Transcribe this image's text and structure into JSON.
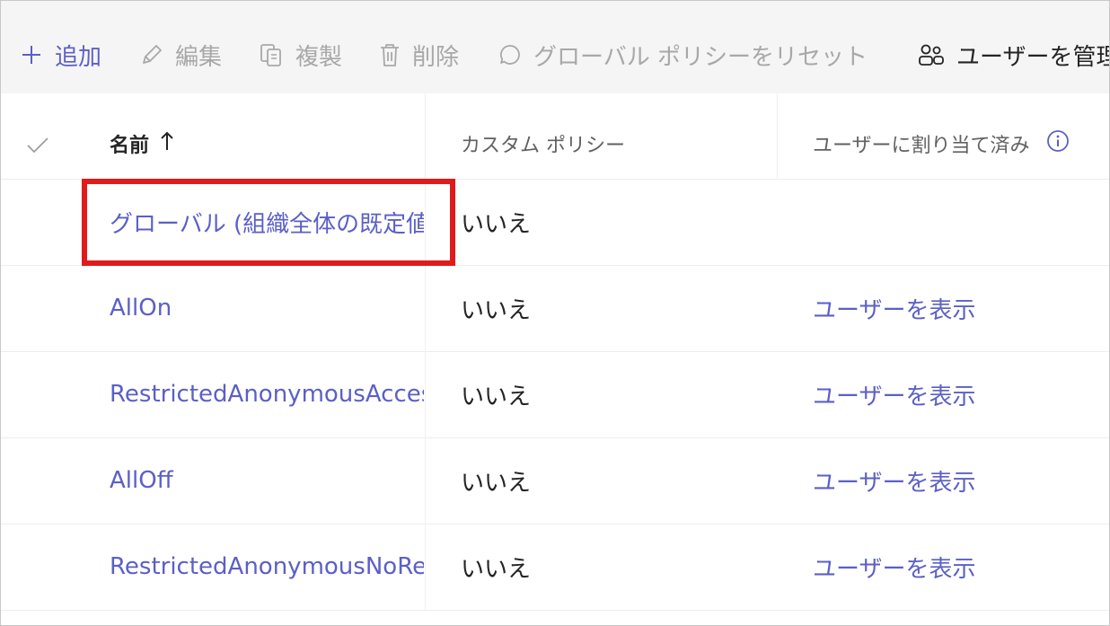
{
  "toolbar": {
    "add": "追加",
    "edit": "編集",
    "duplicate": "複製",
    "delete": "削除",
    "reset_global": "グローバル ポリシーをリセット",
    "manage_users": "ユーザーを管理"
  },
  "table": {
    "columns": {
      "name": "名前",
      "custom_policy": "カスタム ポリシー",
      "assigned_users": "ユーザーに割り当て済み"
    },
    "rows": [
      {
        "name": "グローバル (組織全体の既定値)",
        "custom_policy": "いいえ",
        "assigned_users": ""
      },
      {
        "name": "AllOn",
        "custom_policy": "いいえ",
        "assigned_users": "ユーザーを表示"
      },
      {
        "name": "RestrictedAnonymousAccess",
        "custom_policy": "いいえ",
        "assigned_users": "ユーザーを表示"
      },
      {
        "name": "AllOff",
        "custom_policy": "いいえ",
        "assigned_users": "ユーザーを表示"
      },
      {
        "name": "RestrictedAnonymousNoRecording",
        "custom_policy": "いいえ",
        "assigned_users": "ユーザーを表示"
      }
    ]
  },
  "colors": {
    "accent": "#5b5fc7",
    "highlight_border": "#e01b1b",
    "toolbar_bg": "#f5f5f5"
  },
  "icons": {
    "add": "plus-icon",
    "edit": "pencil-icon",
    "duplicate": "copy-icon",
    "delete": "trash-icon",
    "reset": "chat-bubble-icon",
    "manage_users": "people-icon",
    "sort": "arrow-up-icon",
    "info": "info-icon",
    "select_all": "checkmark-icon"
  }
}
